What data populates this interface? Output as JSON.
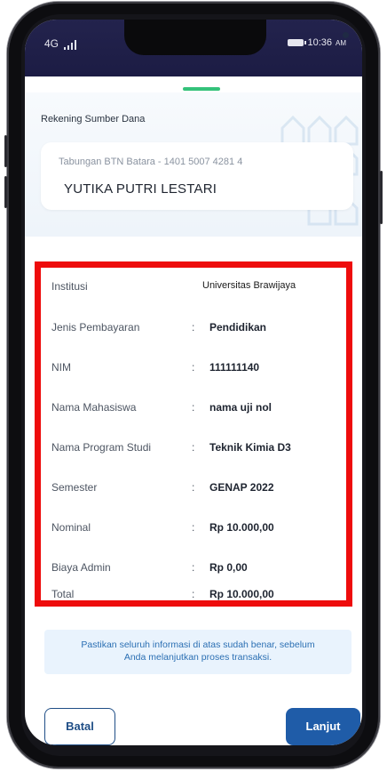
{
  "status_bar": {
    "network": "4G",
    "time": "10:36",
    "time_suffix": "AM"
  },
  "source_section": {
    "label": "Rekening Sumber Dana",
    "account_number": "Tabungan BTN Batara - 1401 5007 4281 4",
    "account_name": "YUTIKA PUTRI LESTARI"
  },
  "details": [
    {
      "label": "Institusi",
      "colon": "",
      "value": "Universitas Brawijaya"
    },
    {
      "label": "Jenis Pembayaran",
      "colon": ":",
      "value": "Pendidikan"
    },
    {
      "label": "NIM",
      "colon": ":",
      "value": "111111140"
    },
    {
      "label": "Nama Mahasiswa",
      "colon": ":",
      "value": "nama uji nol"
    },
    {
      "label": "Nama Program Studi",
      "colon": ":",
      "value": "Teknik Kimia D3"
    },
    {
      "label": "Semester",
      "colon": ":",
      "value": "GENAP 2022"
    },
    {
      "label": "Nominal",
      "colon": ":",
      "value": "Rp 10.000,00"
    },
    {
      "label": "Biaya Admin",
      "colon": ":",
      "value": "Rp 0,00"
    },
    {
      "label": "Total",
      "colon": ":",
      "value": "Rp 10.000,00"
    }
  ],
  "notice": {
    "line1": "Pastikan seluruh informasi di atas sudah benar, sebelum",
    "line2": "Anda melanjutkan proses transaksi."
  },
  "buttons": {
    "cancel": "Batal",
    "next": "Lanjut"
  },
  "colors": {
    "highlight_border": "#ee0c0c",
    "primary": "#1f5ca8",
    "status_bar": "#1c1c44",
    "accent_handle": "#34c27a"
  }
}
